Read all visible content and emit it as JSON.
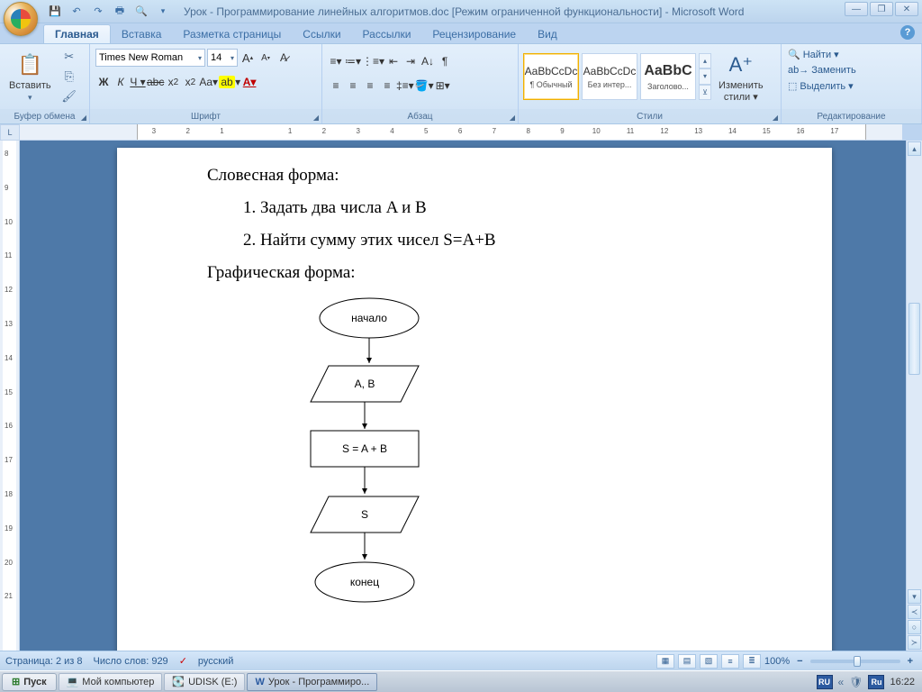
{
  "title": "Урок - Программирование линейных алгоритмов.doc [Режим ограниченной функциональности] - Microsoft Word",
  "tabs": [
    "Главная",
    "Вставка",
    "Разметка страницы",
    "Ссылки",
    "Рассылки",
    "Рецензирование",
    "Вид"
  ],
  "clipboard": {
    "label": "Буфер обмена",
    "paste": "Вставить"
  },
  "font": {
    "label": "Шрифт",
    "name": "Times New Roman",
    "size": "14"
  },
  "paragraph": {
    "label": "Абзац"
  },
  "styles": {
    "label": "Стили",
    "items": [
      {
        "preview": "AaBbCcDc",
        "name": "¶ Обычный"
      },
      {
        "preview": "AaBbCcDc",
        "name": "Без интер..."
      },
      {
        "preview": "AaBbC",
        "name": "Заголово..."
      }
    ],
    "change": "Изменить",
    "change2": "стили"
  },
  "editing": {
    "label": "Редактирование",
    "find": "Найти",
    "replace": "Заменить",
    "select": "Выделить"
  },
  "document": {
    "h1": "Словесная форма:",
    "li1": "1. Задать два числа A и B",
    "li2": "2. Найти сумму этих чисел S=A+B",
    "h2": "Графическая форма:",
    "flow": {
      "start": "начало",
      "input": "A, B",
      "process": "S = A + B",
      "output": "S",
      "end": "конец"
    }
  },
  "status": {
    "page": "Страница: 2 из 8",
    "words": "Число слов: 929",
    "lang": "русский",
    "zoom": "100%"
  },
  "taskbar": {
    "start": "Пуск",
    "items": [
      "Мой компьютер",
      "UDISK (E:)",
      "Урок - Программиро..."
    ],
    "lang": "Ru",
    "time": "16:22",
    "lang2": "RU"
  }
}
